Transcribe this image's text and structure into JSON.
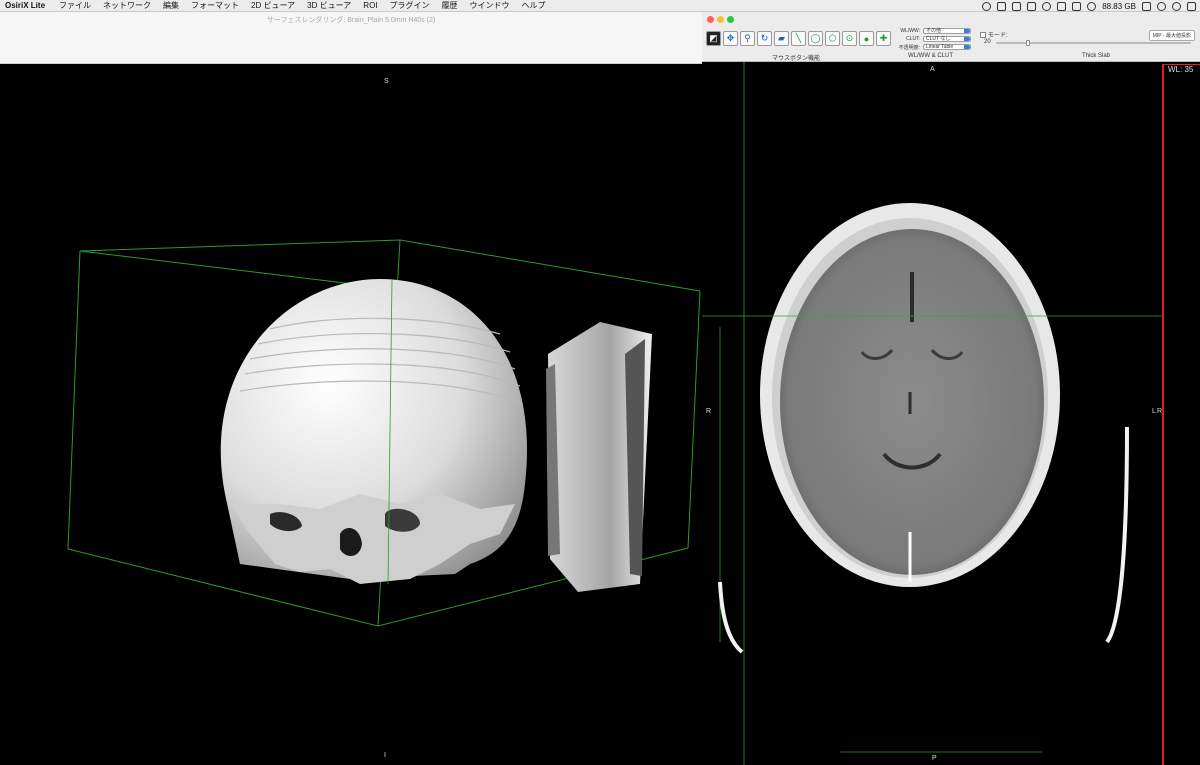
{
  "menubar": {
    "app": "OsiriX Lite",
    "items": [
      "ファイル",
      "ネットワーク",
      "編集",
      "フォーマット",
      "2D ビューア",
      "3D ビューア",
      "ROI",
      "プラグイン",
      "履歴",
      "ウインドウ",
      "ヘルプ"
    ],
    "disk": "88.83 GB"
  },
  "left_window": {
    "title": "サーフェスレンダリング: Brain_Plain 5.0mm H40s (2)",
    "orient_top": "S",
    "orient_bottom": "I"
  },
  "right_window": {
    "sections": {
      "mouse": "マウスボタン機能",
      "wlww": "WL/WW & CLUT",
      "thick": "Thick Slab"
    },
    "wlww": {
      "label": "WL/WW:",
      "value": "その他"
    },
    "clut": {
      "label": "CLUT:",
      "value": "CLUT なし"
    },
    "opacity": {
      "label": "不透明度:",
      "value": "Linear Table"
    },
    "mode_label": "モード:",
    "slab_value": "20",
    "mip_label": "MIP - 最大値投影",
    "orient_top": "A",
    "orient_left": "R",
    "orient_right": "L",
    "orient_right2": "R",
    "orient_bottom": "P",
    "wl_readout": "WL: 35"
  },
  "tools": [
    "window-level",
    "move",
    "zoom",
    "rotate",
    "scroll",
    "length",
    "oval",
    "polygon",
    "point",
    "brush",
    "cross"
  ],
  "colors": {
    "accent": "#1f5fbf",
    "bounding_box": "#2f9a2f",
    "crosshair": "#2faa2f",
    "active_border": "#e02020"
  }
}
